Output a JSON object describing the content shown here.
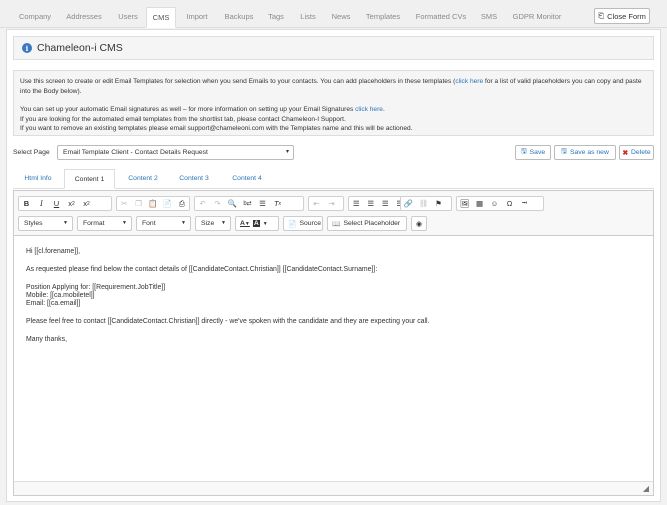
{
  "nav": {
    "tabs": [
      {
        "label": "Company"
      },
      {
        "label": "Addresses"
      },
      {
        "label": "Users"
      },
      {
        "label": "CMS"
      },
      {
        "label": "Import"
      },
      {
        "label": "Backups"
      },
      {
        "label": "Tags"
      },
      {
        "label": "Lists"
      },
      {
        "label": "News"
      },
      {
        "label": "Templates"
      },
      {
        "label": "Formatted CVs"
      },
      {
        "label": "SMS"
      },
      {
        "label": "GDPR Monitor"
      }
    ],
    "active_tab": "CMS",
    "close_label": "Close Form"
  },
  "page": {
    "title": "Chameleon-i CMS"
  },
  "info": {
    "line1a": "Use this screen to create or edit Email Templates for selection when you send Emails to your contacts. You can add placeholders in these templates (",
    "line1_link": "click here",
    "line1b": " for a list of valid placeholders you can copy and paste into the Body below).",
    "line2a": "You can set up your automatic Email signatures as well – for more information on setting up your Email Signatures ",
    "line2_link": "click here",
    "line2b": ".",
    "line3": "If you are looking for the automated email templates from the shortlist tab, please contact Chameleon-I Support.",
    "line4": "If you want to remove an existing templates please email support@chameleoni.com with the Templates name and this will be actioned."
  },
  "select_page": {
    "label": "Select Page",
    "value": "Email Template Client - Contact Details Request"
  },
  "actions": {
    "save": "Save",
    "save_as_new": "Save as new",
    "delete": "Delete"
  },
  "subtabs": [
    {
      "label": "Html Info"
    },
    {
      "label": "Content 1"
    },
    {
      "label": "Content 2"
    },
    {
      "label": "Content 3"
    },
    {
      "label": "Content 4"
    }
  ],
  "editor": {
    "styles": "Styles",
    "format": "Format",
    "font": "Font",
    "size": "Size",
    "source": "Source",
    "select_placeholder": "Select Placeholder",
    "body": {
      "greeting": "Hi [[cl.forename]],",
      "intro": "As requested please find below the contact details of [[CandidateContact.Christian]] [[CandidateContact.Surname]]:",
      "position": "Position Applying for: [[Requirement.JobTitle]]",
      "mobile": "Mobile: [[ca.mobiletel]]",
      "email": "Email: [[ca.email]]",
      "contact": "Please feel free to contact [[CandidateContact.Christian]] directly - we've spoken with the candidate and they are expecting your call.",
      "signoff": "Many thanks,"
    }
  },
  "colors": {
    "accent": "#2a74b8",
    "info_icon": "#3a78c3",
    "delete_icon": "#c9302c"
  }
}
